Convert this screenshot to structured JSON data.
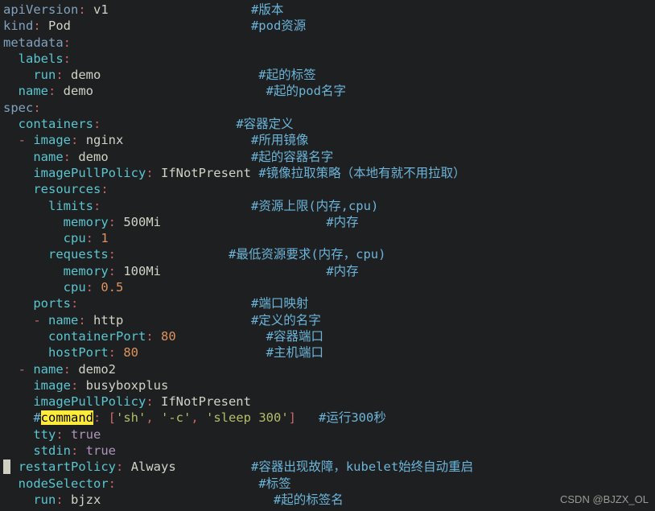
{
  "lines": [
    [
      [
        "k",
        "apiVersion"
      ],
      [
        "p",
        ": "
      ],
      [
        "v",
        "v1"
      ],
      [
        "sp",
        19
      ],
      [
        "cm",
        "#版本"
      ]
    ],
    [
      [
        "k",
        "kind"
      ],
      [
        "p",
        ": "
      ],
      [
        "v",
        "Pod"
      ],
      [
        "sp",
        24
      ],
      [
        "cm",
        "#pod资源"
      ]
    ],
    [
      [
        "k",
        "metadata"
      ],
      [
        "p",
        ":"
      ]
    ],
    [
      [
        "sp",
        2
      ],
      [
        "c",
        "labels"
      ],
      [
        "p",
        ":"
      ]
    ],
    [
      [
        "sp",
        4
      ],
      [
        "c",
        "run"
      ],
      [
        "p",
        ": "
      ],
      [
        "v",
        "demo"
      ],
      [
        "sp",
        21
      ],
      [
        "cm",
        "#起的标签"
      ]
    ],
    [
      [
        "sp",
        2
      ],
      [
        "c",
        "name"
      ],
      [
        "p",
        ": "
      ],
      [
        "v",
        "demo"
      ],
      [
        "sp",
        23
      ],
      [
        "cm",
        "#起的pod名字"
      ]
    ],
    [
      [
        "k",
        "spec"
      ],
      [
        "p",
        ":"
      ]
    ],
    [
      [
        "sp",
        2
      ],
      [
        "c",
        "containers"
      ],
      [
        "p",
        ":"
      ],
      [
        "sp",
        18
      ],
      [
        "cm",
        "#容器定义"
      ]
    ],
    [
      [
        "sp",
        2
      ],
      [
        "p",
        "- "
      ],
      [
        "c",
        "image"
      ],
      [
        "p",
        ": "
      ],
      [
        "v",
        "nginx"
      ],
      [
        "sp",
        17
      ],
      [
        "cm",
        "#所用镜像"
      ]
    ],
    [
      [
        "sp",
        4
      ],
      [
        "c",
        "name"
      ],
      [
        "p",
        ": "
      ],
      [
        "v",
        "demo"
      ],
      [
        "sp",
        19
      ],
      [
        "cm",
        "#起的容器名字"
      ]
    ],
    [
      [
        "sp",
        4
      ],
      [
        "c",
        "imagePullPolicy"
      ],
      [
        "p",
        ": "
      ],
      [
        "v",
        "IfNotPresent "
      ],
      [
        "cm",
        "#镜像拉取策略（本地有就不用拉取）"
      ]
    ],
    [
      [
        "sp",
        4
      ],
      [
        "c",
        "resources"
      ],
      [
        "p",
        ":"
      ]
    ],
    [
      [
        "sp",
        6
      ],
      [
        "c",
        "limits"
      ],
      [
        "p",
        ":"
      ],
      [
        "sp",
        20
      ],
      [
        "cm",
        "#资源上限(内存,cpu)"
      ]
    ],
    [
      [
        "sp",
        8
      ],
      [
        "c",
        "memory"
      ],
      [
        "p",
        ": "
      ],
      [
        "v",
        "500Mi"
      ],
      [
        "sp",
        22
      ],
      [
        "cm",
        "#内存"
      ]
    ],
    [
      [
        "sp",
        8
      ],
      [
        "c",
        "cpu"
      ],
      [
        "p",
        ": "
      ],
      [
        "n",
        "1"
      ]
    ],
    [
      [
        "sp",
        6
      ],
      [
        "c",
        "requests"
      ],
      [
        "p",
        ":"
      ],
      [
        "sp",
        15
      ],
      [
        "cm",
        "#最低资源要求(内存，cpu)"
      ]
    ],
    [
      [
        "sp",
        8
      ],
      [
        "c",
        "memory"
      ],
      [
        "p",
        ": "
      ],
      [
        "v",
        "100Mi"
      ],
      [
        "sp",
        22
      ],
      [
        "cm",
        "#内存"
      ]
    ],
    [
      [
        "sp",
        8
      ],
      [
        "c",
        "cpu"
      ],
      [
        "p",
        ": "
      ],
      [
        "n",
        "0.5"
      ]
    ],
    [
      [
        "sp",
        4
      ],
      [
        "c",
        "ports"
      ],
      [
        "p",
        ":"
      ],
      [
        "sp",
        23
      ],
      [
        "cm",
        "#端口映射"
      ]
    ],
    [
      [
        "sp",
        4
      ],
      [
        "p",
        "- "
      ],
      [
        "c",
        "name"
      ],
      [
        "p",
        ": "
      ],
      [
        "v",
        "http"
      ],
      [
        "sp",
        17
      ],
      [
        "cm",
        "#定义的名字"
      ]
    ],
    [
      [
        "sp",
        6
      ],
      [
        "c",
        "containerPort"
      ],
      [
        "p",
        ": "
      ],
      [
        "n",
        "80"
      ],
      [
        "sp",
        12
      ],
      [
        "cm",
        "#容器端口"
      ]
    ],
    [
      [
        "sp",
        6
      ],
      [
        "c",
        "hostPort"
      ],
      [
        "p",
        ": "
      ],
      [
        "n",
        "80"
      ],
      [
        "sp",
        17
      ],
      [
        "cm",
        "#主机端口"
      ]
    ],
    [
      [
        "sp",
        2
      ],
      [
        "p",
        "- "
      ],
      [
        "c",
        "name"
      ],
      [
        "p",
        ": "
      ],
      [
        "v",
        "demo2"
      ]
    ],
    [
      [
        "sp",
        4
      ],
      [
        "c",
        "image"
      ],
      [
        "p",
        ": "
      ],
      [
        "v",
        "busyboxplus"
      ]
    ],
    [
      [
        "sp",
        4
      ],
      [
        "c",
        "imagePullPolicy"
      ],
      [
        "p",
        ": "
      ],
      [
        "v",
        "IfNotPresent"
      ]
    ],
    [
      [
        "sp",
        4
      ],
      [
        "cm",
        "#"
      ],
      [
        "hl",
        "command"
      ],
      [
        "p",
        ": "
      ],
      [
        "p",
        "["
      ],
      [
        "s",
        "'sh'"
      ],
      [
        "p",
        ", "
      ],
      [
        "s",
        "'-c'"
      ],
      [
        "p",
        ", "
      ],
      [
        "s",
        "'sleep 300'"
      ],
      [
        "p",
        "]"
      ],
      [
        "sp",
        3
      ],
      [
        "cm",
        "#运行300秒"
      ]
    ],
    [
      [
        "sp",
        4
      ],
      [
        "c",
        "tty"
      ],
      [
        "p",
        ": "
      ],
      [
        "b",
        "true"
      ]
    ],
    [
      [
        "sp",
        4
      ],
      [
        "c",
        "stdin"
      ],
      [
        "p",
        ": "
      ],
      [
        "b",
        "true"
      ]
    ],
    [
      [
        "blk",
        " "
      ],
      [
        "sp",
        1
      ],
      [
        "c",
        "restartPolicy"
      ],
      [
        "p",
        ": "
      ],
      [
        "v",
        "Always"
      ],
      [
        "sp",
        10
      ],
      [
        "cm",
        "#容器出现故障，kubelet始终自动重启"
      ]
    ],
    [
      [
        "sp",
        2
      ],
      [
        "c",
        "nodeSelector"
      ],
      [
        "p",
        ":"
      ],
      [
        "sp",
        19
      ],
      [
        "cm",
        "#标签"
      ]
    ],
    [
      [
        "sp",
        4
      ],
      [
        "c",
        "run"
      ],
      [
        "p",
        ": "
      ],
      [
        "v",
        "bjzx"
      ],
      [
        "sp",
        23
      ],
      [
        "cm",
        "#起的标签名"
      ]
    ]
  ],
  "watermark": "CSDN @BJZX_OL"
}
